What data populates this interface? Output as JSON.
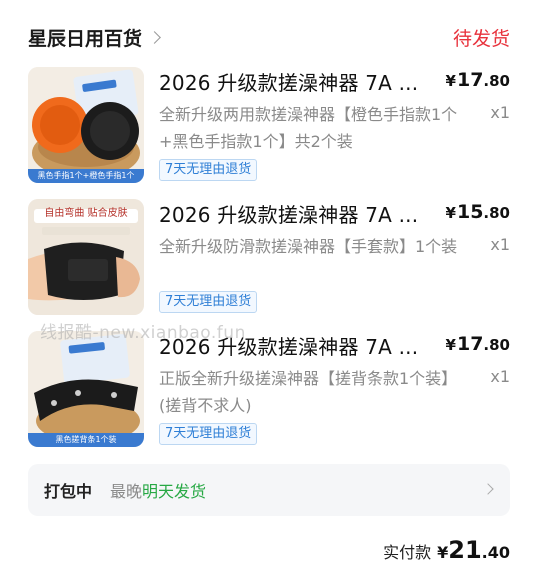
{
  "header": {
    "store_name": "星辰日用百货",
    "order_status": "待发货"
  },
  "items": [
    {
      "title": "2026 升级款搓澡神器 7A ...",
      "price_currency": "¥",
      "price_int": "17",
      "price_dec": ".80",
      "spec": "全新升级两用款搓澡神器【橙色手指款1个+黑色手指款1个】共2个装",
      "qty": "x1",
      "tag": "7天无理由退货",
      "thumb_caption": "黑色手指1个+橙色手指1个"
    },
    {
      "title": "2026 升级款搓澡神器 7A ...",
      "price_currency": "¥",
      "price_int": "15",
      "price_dec": ".80",
      "spec": "全新升级防滑款搓澡神器【手套款】1个装",
      "qty": "x1",
      "tag": "7天无理由退货",
      "thumb_caption": "自由弯曲 贴合皮肤"
    },
    {
      "title": "2026 升级款搓澡神器 7A ...",
      "price_currency": "¥",
      "price_int": "17",
      "price_dec": ".80",
      "spec": "正版全新升级搓澡神器【搓背条款1个装】(搓背不求人)",
      "qty": "x1",
      "tag": "7天无理由退货",
      "thumb_caption": "黑色搓背条1个装"
    }
  ],
  "watermark": "线报酷-new.xianbao.fun",
  "shipping": {
    "status": "打包中",
    "prefix": "最晚",
    "highlight": "明天发货"
  },
  "total": {
    "label": "实付款",
    "currency": "¥",
    "int": "21",
    "dec": ".40"
  },
  "colors": {
    "status_red": "#e8323c",
    "ship_green": "#27a844",
    "tag_blue": "#2f7fd6"
  }
}
